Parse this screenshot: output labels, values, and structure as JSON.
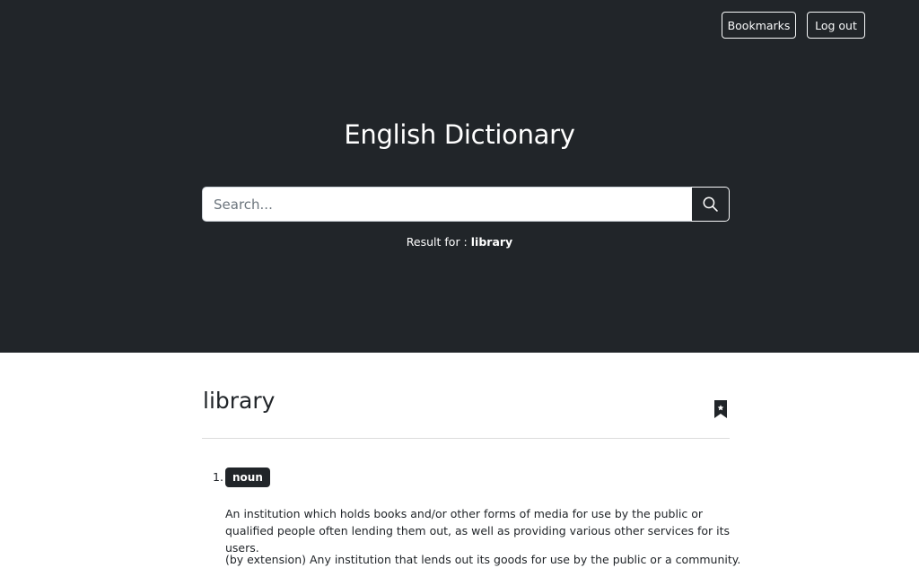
{
  "nav": {
    "bookmarks_label": "Bookmarks",
    "logout_label": "Log out"
  },
  "header": {
    "title": "English Dictionary"
  },
  "search": {
    "placeholder": "Search...",
    "value": ""
  },
  "result": {
    "prefix": "Result for :",
    "word": "library"
  },
  "entry": {
    "word": "library",
    "meanings": [
      {
        "number": "1.",
        "part_of_speech": "noun",
        "definitions": [
          "An institution which holds books and/or other forms of media for use by the public or qualified people often lending them out, as well as providing various other services for its users.",
          "(by extension) Any institution that lends out its goods for use by the public or a community."
        ]
      }
    ]
  },
  "colors": {
    "hero_bg": "#212529",
    "badge_bg": "#212529",
    "text": "#212529"
  },
  "icons": {
    "search": "search-icon",
    "bookmark": "bookmark-icon"
  }
}
